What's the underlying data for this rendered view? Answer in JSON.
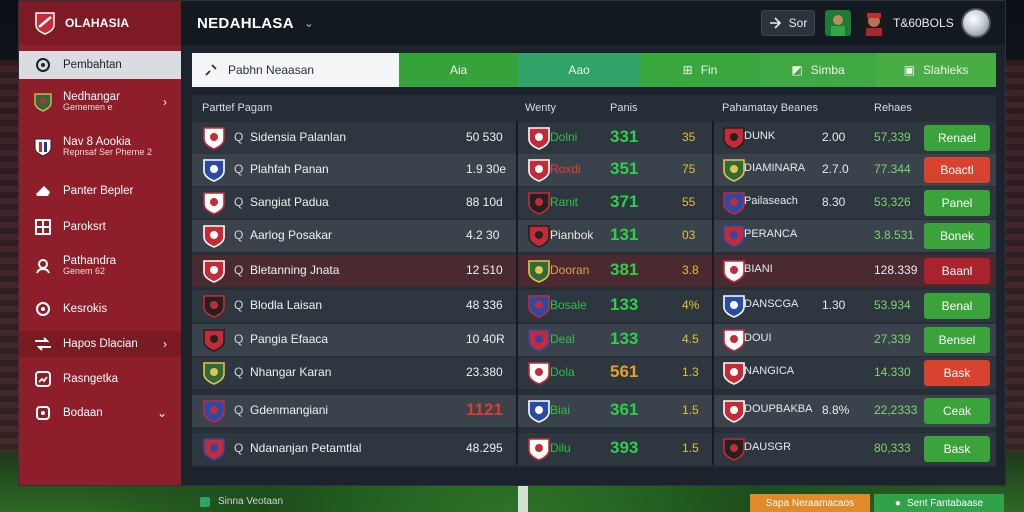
{
  "app": {
    "brand": "OLAHASIA",
    "title": "NEDAHLASA"
  },
  "sidebar": {
    "items": [
      {
        "label": "Pembahtan",
        "sub": ""
      },
      {
        "label": "Nedhangar",
        "sub": "Gememen e"
      },
      {
        "label": "Nav 8 Aookia",
        "sub": "Repnsaf Ser Pherne 2"
      },
      {
        "label": "Panter Bepler",
        "sub": ""
      },
      {
        "label": "Paroksrt",
        "sub": ""
      },
      {
        "label": "Pathandra",
        "sub": "Genem 62"
      },
      {
        "label": "Kesrokis",
        "sub": ""
      },
      {
        "label": "Hapos Dlacian",
        "sub": ""
      },
      {
        "label": "Rasngetka",
        "sub": ""
      },
      {
        "label": "Bodaan",
        "sub": ""
      }
    ]
  },
  "topbar": {
    "sort_label": "Sor",
    "username": "T&60BOLS"
  },
  "filters": {
    "search_value": "Pabhn Neaasan",
    "tabs": [
      "Aia",
      "Aao",
      "Fin",
      "Simba",
      "Slahieks"
    ]
  },
  "table": {
    "headers": {
      "team": "Parttef Pagam",
      "money": "Wenty",
      "points": "Panis",
      "partner": "Pahamatay Beanes",
      "rating": "Rehaes"
    },
    "rows": [
      {
        "team": "Sidensia Palanlan",
        "value": "50 530",
        "code": "Dolni",
        "points": "331",
        "form": "35",
        "opp": "DUNK",
        "odds": "2.00",
        "amount": "57,339",
        "action": "Renael"
      },
      {
        "team": "Plahfah Panan",
        "value": "1.9 30e",
        "code": "Roxdi",
        "points": "351",
        "form": "75",
        "opp": "DIAMINARA",
        "odds": "2.7.0",
        "amount": "77.344",
        "action": "Boactl"
      },
      {
        "team": "Sangiat Padua",
        "value": "88 10d",
        "code": "Ranit",
        "points": "371",
        "form": "55",
        "opp": "Pailaseach",
        "odds": "8.30",
        "amount": "53,326",
        "action": "Panel"
      },
      {
        "team": "Aarlog Posakar",
        "value": "4.2 30",
        "code": "Pianbok",
        "points": "131",
        "form": "03",
        "opp": "PERANCA",
        "odds": "",
        "amount": "3.8.531",
        "action": "Bonek"
      },
      {
        "team": "Bletanning Jnata",
        "value": "12 510",
        "code": "Dooran",
        "points": "381",
        "form": "3.8",
        "opp": "BIANI",
        "odds": "",
        "amount": "128.339",
        "action": "Baanl"
      },
      {
        "team": "Blodla Laisan",
        "value": "48 336",
        "code": "Bosale",
        "points": "133",
        "form": "4%",
        "opp": "DANSCGA",
        "odds": "1.30",
        "amount": "53.934",
        "action": "Benal"
      },
      {
        "team": "Pangia Efaaca",
        "value": "10 40R",
        "code": "Deal",
        "points": "133",
        "form": "4.5",
        "opp": "DOUI",
        "odds": "",
        "amount": "27,339",
        "action": "Bensel"
      },
      {
        "team": "Nhangar Karan",
        "value": "23.380",
        "code": "Dola",
        "points": "561",
        "form": "1.3",
        "opp": "NANGICA",
        "odds": "",
        "amount": "14.330",
        "action": "Bask"
      },
      {
        "team": "Gdenmangiani",
        "value": "1121",
        "code": "Biai",
        "points": "361",
        "form": "1.5",
        "opp": "DOUPBAKBA",
        "odds": "8.8%",
        "amount": "22,2333",
        "action": "Ceak"
      },
      {
        "team": "Ndananjan Petamtlal",
        "value": "48.295",
        "code": "Dilu",
        "points": "393",
        "form": "1.5",
        "opp": "DAUSGR",
        "odds": "",
        "amount": "80,333",
        "action": "Bask"
      }
    ]
  },
  "bottom": {
    "left_text": "Sinna Veotaan",
    "pill1": "Sapa Neraamacaos",
    "pill2": "Sent Fantabaase"
  }
}
